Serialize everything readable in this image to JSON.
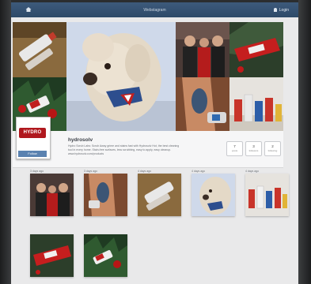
{
  "topbar": {
    "title": "Webstagram",
    "user_label": "Login"
  },
  "profile": {
    "logo_text": "HYDRO",
    "follow_label": "Follow",
    "username": "hydrosolv",
    "bio_line1": "Hydro Scrub Labs: Scrub Away grime and stains fast with Hydrosolv Hot, the best cleaning",
    "bio_line2": "tool in every home. Stain-free surfaces, less scrubbing, easy to apply, easy cleanup.",
    "bio_link": "www.hydrosolv.com/products",
    "stats": [
      {
        "num": "7",
        "label": "posts"
      },
      {
        "num": "3",
        "label": "followers"
      },
      {
        "num": "2",
        "label": "following"
      }
    ]
  },
  "grid": {
    "row1": [
      "3 days ago",
      "3 days ago",
      "4 days ago",
      "4 days ago",
      "4 days ago"
    ],
    "row2": [
      "",
      ""
    ]
  },
  "colors": {
    "topbar": "#344f70",
    "logo_red": "#b0181e",
    "page_bg": "#e9e9ea"
  }
}
